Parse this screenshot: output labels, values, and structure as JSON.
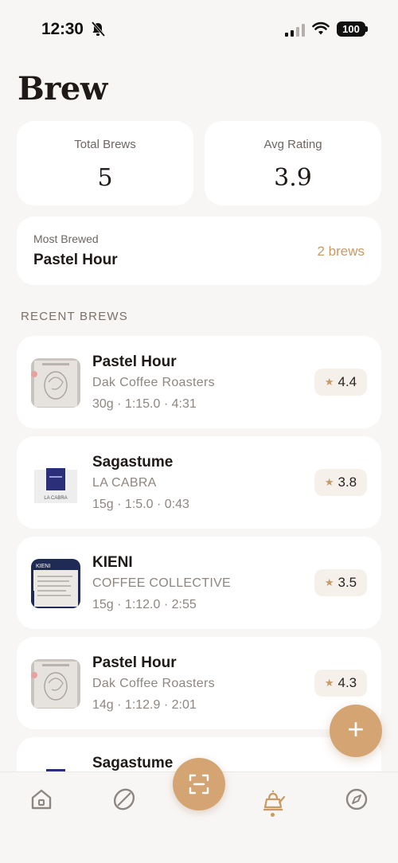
{
  "status_bar": {
    "time": "12:30",
    "battery": "100"
  },
  "page": {
    "title": "Brew"
  },
  "stats": [
    {
      "label": "Total Brews",
      "value": "5"
    },
    {
      "label": "Avg Rating",
      "value": "3.9"
    }
  ],
  "most_brewed": {
    "label": "Most Brewed",
    "name": "Pastel Hour",
    "count": "2 brews"
  },
  "recent": {
    "header": "RECENT BREWS",
    "items": [
      {
        "name": "Pastel Hour",
        "roaster": "Dak Coffee Roasters",
        "details": "30g · 1:15.0 · 4:31",
        "rating": "4.4",
        "thumb": "pastel"
      },
      {
        "name": "Sagastume",
        "roaster": "LA CABRA",
        "details": "15g · 1:5.0 · 0:43",
        "rating": "3.8",
        "thumb": "lacabra"
      },
      {
        "name": "KIENI",
        "roaster": "COFFEE COLLECTIVE",
        "details": "15g · 1:12.0 · 2:55",
        "rating": "3.5",
        "thumb": "kieni"
      },
      {
        "name": "Pastel Hour",
        "roaster": "Dak Coffee Roasters",
        "details": "14g · 1:12.9 · 2:01",
        "rating": "4.3",
        "thumb": "pastel"
      },
      {
        "name": "Sagastume",
        "roaster": "",
        "details": "",
        "rating": "",
        "thumb": "lacabra"
      }
    ]
  },
  "thumb_labels": {
    "kieni": "KIENI",
    "lacabra": "LA CABRA"
  },
  "colors": {
    "accent": "#d4a573",
    "accent_text": "#c79a66",
    "background": "#f8f6f5"
  },
  "icons": {
    "tabs": [
      "home-icon",
      "coffee-bean-icon",
      "scan-icon",
      "kettle-icon",
      "compass-icon"
    ],
    "fab": "plus-icon",
    "rating": "star-icon"
  },
  "fab_label": "+",
  "tabs": {
    "active": "kettle-icon"
  }
}
